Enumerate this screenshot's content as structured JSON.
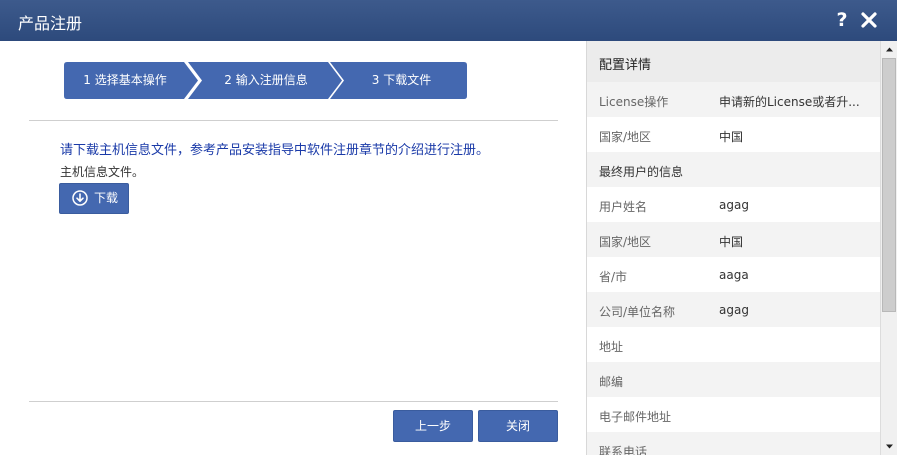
{
  "window": {
    "title": "产品注册",
    "help_label": "?"
  },
  "steps": [
    {
      "label": "1 选择基本操作"
    },
    {
      "label": "2 输入注册信息"
    },
    {
      "label": "3 下载文件"
    }
  ],
  "content": {
    "message": "请下载主机信息文件，参考产品安装指导中软件注册章节的介绍进行注册。",
    "subtext": "主机信息文件。",
    "download_label": "下载"
  },
  "footer": {
    "prev_label": "上一步",
    "close_label": "关闭"
  },
  "details": {
    "title": "配置详情",
    "rows": [
      {
        "key": "License操作",
        "value": "申请新的License或者升..."
      },
      {
        "key": "国家/地区",
        "value": "中国"
      },
      {
        "key": "最终用户的信息",
        "value": ""
      },
      {
        "key": "用户姓名",
        "value": "agag"
      },
      {
        "key": "国家/地区",
        "value": "中国"
      },
      {
        "key": "省/市",
        "value": "aaga"
      },
      {
        "key": "公司/单位名称",
        "value": "agag"
      },
      {
        "key": "地址",
        "value": ""
      },
      {
        "key": "邮编",
        "value": ""
      },
      {
        "key": "电子邮件地址",
        "value": ""
      },
      {
        "key": "联系电话",
        "value": ""
      }
    ]
  },
  "colors": {
    "titlebar": "#2d4a7c",
    "step_fill": "#4468b0",
    "link_text": "#1a3aa8",
    "button": "#4468b0"
  },
  "icons": [
    "close-icon",
    "help-icon",
    "download-circle-icon",
    "scroll-up-arrow-icon",
    "scroll-down-arrow-icon"
  ]
}
